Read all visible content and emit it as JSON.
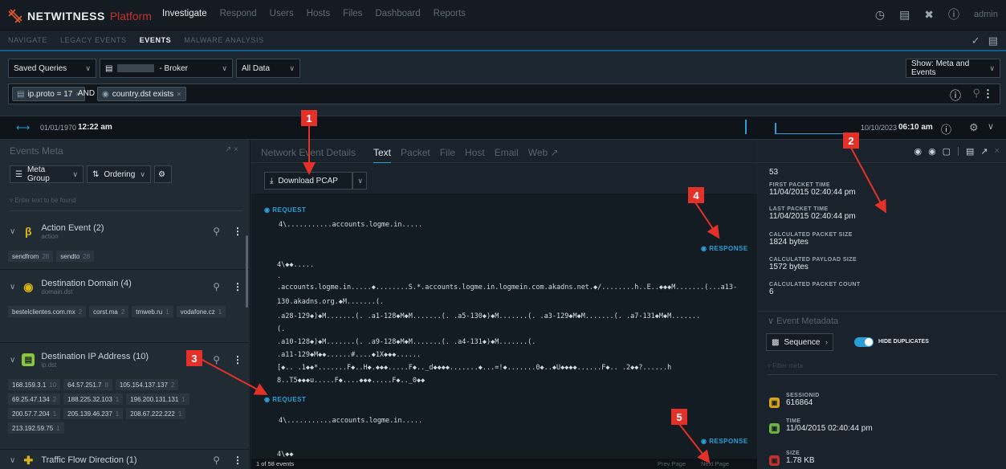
{
  "app": {
    "brand": "NETWITNESS",
    "platform": "Platform",
    "nav": [
      "Investigate",
      "Respond",
      "Users",
      "Hosts",
      "Files",
      "Dashboard",
      "Reports"
    ],
    "user": "admin"
  },
  "subnav": {
    "tabs": [
      "NAVIGATE",
      "LEGACY EVENTS",
      "EVENTS",
      "MALWARE ANALYSIS"
    ]
  },
  "query": {
    "saved_queries": "Saved Queries",
    "service": "- Broker",
    "scope": "All Data",
    "show": "Show: Meta and Events",
    "pill1": "ip.proto = 17",
    "operator": "AND",
    "pill2": "country.dst exists"
  },
  "timeline": {
    "start_date": "01/01/1970",
    "start_time": "12:22 am",
    "end_date": "10/10/2023",
    "end_time": "06:10 am"
  },
  "meta_panel": {
    "title": "Events Meta",
    "meta_group": "Meta Group",
    "ordering": "Ordering",
    "filter_placeholder": "Enter text to be found",
    "groups": [
      {
        "title": "Action Event (2)",
        "sub": "action",
        "values": [
          {
            "v": "sendfrom",
            "n": "28"
          },
          {
            "v": "sendto",
            "n": "28"
          }
        ]
      },
      {
        "title": "Destination Domain (4)",
        "sub": "domain.dst",
        "values": [
          {
            "v": "bestelclientes.com.mx",
            "n": "2"
          },
          {
            "v": "corst.ma",
            "n": "2"
          },
          {
            "v": "tmweb.ru",
            "n": "1"
          },
          {
            "v": "vodafone.cz",
            "n": "1"
          }
        ]
      },
      {
        "title": "Destination IP Address (10)",
        "sub": "ip.dst",
        "values": [
          {
            "v": "168.159.3.1",
            "n": "10"
          },
          {
            "v": "64.57.251.7",
            "n": "8"
          },
          {
            "v": "105.154.137.137",
            "n": "2"
          },
          {
            "v": "69.25.47.134",
            "n": "2"
          },
          {
            "v": "188.225.32.103",
            "n": "1"
          },
          {
            "v": "196.200.131.131",
            "n": "1"
          },
          {
            "v": "200.57.7.204",
            "n": "1"
          },
          {
            "v": "205.139.46.237",
            "n": "1"
          },
          {
            "v": "208.67.222.222",
            "n": "1"
          },
          {
            "v": "213.192.59.75",
            "n": "1"
          }
        ]
      },
      {
        "title": "Traffic Flow Direction (1)",
        "sub": "",
        "values": []
      }
    ]
  },
  "event_panel": {
    "title": "Network Event Details",
    "tabs": [
      "Text",
      "Packet",
      "File",
      "Host",
      "Email",
      "Web"
    ],
    "download": "Download PCAP",
    "request_label": "REQUEST",
    "response_label": "RESPONSE",
    "lines": {
      "req1": "4\\...........accounts.logme.in.....",
      "resp_a": "4\\◆◆.....",
      "resp_b": ".",
      "resp_c": ".accounts.logme.in.....◆........S.*.accounts.logme.in.logmein.com.akadns.net.◆/........h..E..◆◆◆M.......(...a13-",
      "resp_d": "130.akadns.org.◆M.......(.",
      "resp_e": ".a28-129◆)◆M.......(.  .a1-128◆M◆M.......(.  .a5-130◆)◆M.......(.  .a3-129◆M◆M.......(.  .a7-131◆M◆M.......",
      "resp_f": "(.",
      "resp_g": ".a10-128◆)◆M.......(.  .a9-128◆M◆M.......(.  .a4-131◆)◆M.......(.",
      "resp_h": ".a11-129◆M◆◆......#....◆1X◆◆◆......",
      "resp_i": "[◆.. .1◆◆*.......F◆..H◆.◆◆◆.....F◆.._d◆◆◆◆.......◆...=!◆.......0◆..◆U◆◆◆◆......F◆.. .2◆◆?......h",
      "resp_j": "8..T5◆◆◆u.....F◆....◆◆◆.....F◆.._0◆◆",
      "req2": "4\\...........accounts.logme.in.....",
      "resp2_a": "4\\◆◆"
    },
    "footer_count": "1 of 58 events",
    "prev_page": "Prev Page",
    "next_page": "Next Page"
  },
  "meta_right": {
    "top_value": "53",
    "fields": [
      {
        "label": "FIRST PACKET TIME",
        "value": "11/04/2015 02:40:44 pm"
      },
      {
        "label": "LAST PACKET TIME",
        "value": "11/04/2015 02:40:44 pm"
      },
      {
        "label": "CALCULATED PACKET SIZE",
        "value": "1824 bytes"
      },
      {
        "label": "CALCULATED PAYLOAD SIZE",
        "value": "1572 bytes"
      },
      {
        "label": "CALCULATED PACKET COUNT",
        "value": "6"
      }
    ],
    "section_title": "Event Metadata",
    "sequence": "Sequence",
    "hide_dup": "HIDE DUPLICATES",
    "filter_placeholder": "Filter meta",
    "meta": [
      {
        "label": "SESSIONID",
        "value": "616864",
        "color": "#d9a516"
      },
      {
        "label": "TIME",
        "value": "11/04/2015 02:40:44 pm",
        "color": "#6db33f"
      },
      {
        "label": "SIZE",
        "value": "1.78 KB",
        "color": "#c4302b"
      }
    ]
  },
  "callouts": [
    "1",
    "2",
    "3",
    "4",
    "5"
  ]
}
